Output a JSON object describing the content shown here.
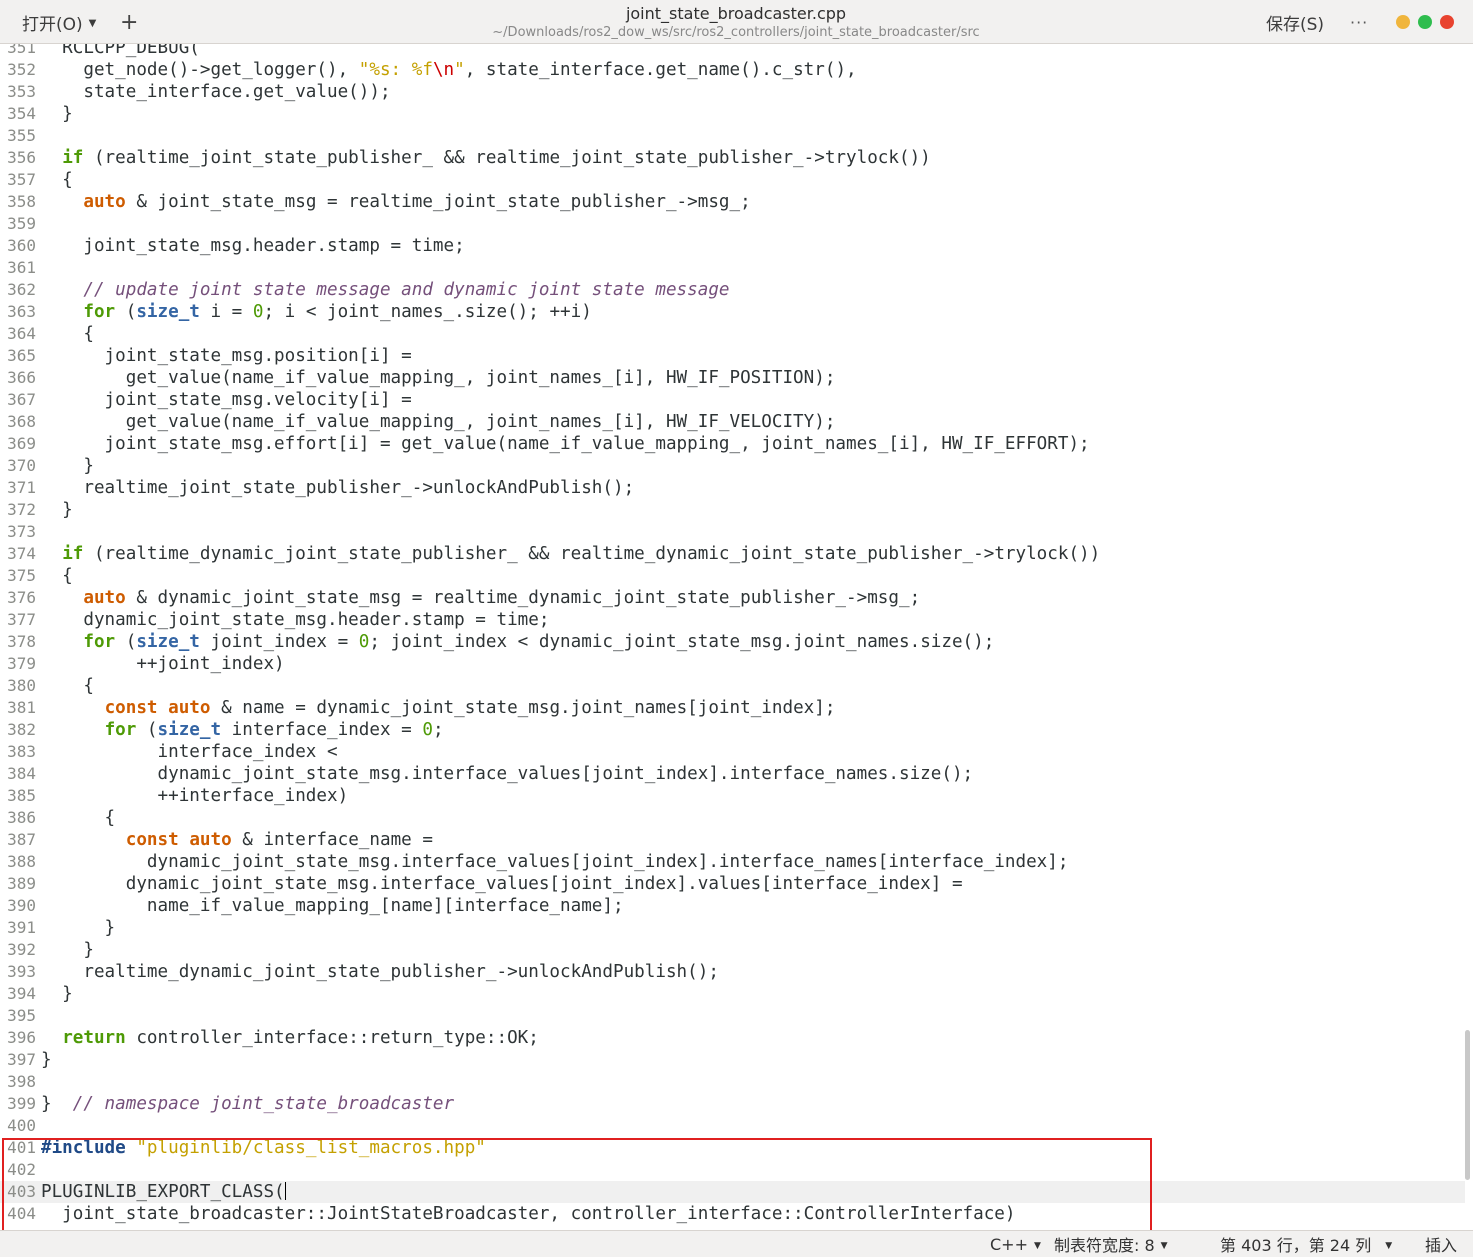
{
  "header": {
    "open_label": "打开(O)",
    "new_tab_symbol": "+",
    "title": "joint_state_broadcaster.cpp",
    "subtitle": "~/Downloads/ros2_dow_ws/src/ros2_controllers/joint_state_broadcaster/src",
    "save_label": "保存(S)",
    "more_symbol": "···"
  },
  "colors": {
    "keyword": "#4e9a06",
    "keyword_alt": "#ce5c00",
    "type": "#3465a4",
    "string": "#c4a000",
    "comment": "#75507b",
    "highlight_box": "#e02020"
  },
  "editor": {
    "current_line": 403,
    "lines": [
      {
        "n": "351",
        "t": [
          [
            "  RCLCPP_DEBUG(",
            ""
          ]
        ]
      },
      {
        "n": "352",
        "t": [
          [
            "    get_node()->get_logger(), ",
            ""
          ],
          [
            "\"%s: %f",
            "str"
          ],
          [
            "\\n",
            "esc"
          ],
          [
            "\"",
            "str"
          ],
          [
            ", state_interface.get_name().c_str(),",
            ""
          ]
        ]
      },
      {
        "n": "353",
        "t": [
          [
            "    state_interface.get_value());",
            ""
          ]
        ]
      },
      {
        "n": "354",
        "t": [
          [
            "  }",
            ""
          ]
        ]
      },
      {
        "n": "355",
        "t": []
      },
      {
        "n": "356",
        "t": [
          [
            "  ",
            ""
          ],
          [
            "if",
            "kw"
          ],
          [
            " (realtime_joint_state_publisher_ && realtime_joint_state_publisher_->trylock())",
            ""
          ]
        ]
      },
      {
        "n": "357",
        "t": [
          [
            "  {",
            ""
          ]
        ]
      },
      {
        "n": "358",
        "t": [
          [
            "    ",
            ""
          ],
          [
            "auto",
            "kw2"
          ],
          [
            " & joint_state_msg = realtime_joint_state_publisher_->msg_;",
            ""
          ]
        ]
      },
      {
        "n": "359",
        "t": []
      },
      {
        "n": "360",
        "t": [
          [
            "    joint_state_msg.header.stamp = time;",
            ""
          ]
        ]
      },
      {
        "n": "361",
        "t": []
      },
      {
        "n": "362",
        "t": [
          [
            "    ",
            ""
          ],
          [
            "// update joint state message and dynamic joint state message",
            "cmt"
          ]
        ]
      },
      {
        "n": "363",
        "t": [
          [
            "    ",
            ""
          ],
          [
            "for",
            "kw"
          ],
          [
            " (",
            ""
          ],
          [
            "size_t",
            "ty"
          ],
          [
            " i = ",
            ""
          ],
          [
            "0",
            "num"
          ],
          [
            "; i < joint_names_.size(); ++i)",
            ""
          ]
        ]
      },
      {
        "n": "364",
        "t": [
          [
            "    {",
            ""
          ]
        ]
      },
      {
        "n": "365",
        "t": [
          [
            "      joint_state_msg.position[i] =",
            ""
          ]
        ]
      },
      {
        "n": "366",
        "t": [
          [
            "        get_value(name_if_value_mapping_, joint_names_[i], HW_IF_POSITION);",
            ""
          ]
        ]
      },
      {
        "n": "367",
        "t": [
          [
            "      joint_state_msg.velocity[i] =",
            ""
          ]
        ]
      },
      {
        "n": "368",
        "t": [
          [
            "        get_value(name_if_value_mapping_, joint_names_[i], HW_IF_VELOCITY);",
            ""
          ]
        ]
      },
      {
        "n": "369",
        "t": [
          [
            "      joint_state_msg.effort[i] = get_value(name_if_value_mapping_, joint_names_[i], HW_IF_EFFORT);",
            ""
          ]
        ]
      },
      {
        "n": "370",
        "t": [
          [
            "    }",
            ""
          ]
        ]
      },
      {
        "n": "371",
        "t": [
          [
            "    realtime_joint_state_publisher_->unlockAndPublish();",
            ""
          ]
        ]
      },
      {
        "n": "372",
        "t": [
          [
            "  }",
            ""
          ]
        ]
      },
      {
        "n": "373",
        "t": []
      },
      {
        "n": "374",
        "t": [
          [
            "  ",
            ""
          ],
          [
            "if",
            "kw"
          ],
          [
            " (realtime_dynamic_joint_state_publisher_ && realtime_dynamic_joint_state_publisher_->trylock())",
            ""
          ]
        ]
      },
      {
        "n": "375",
        "t": [
          [
            "  {",
            ""
          ]
        ]
      },
      {
        "n": "376",
        "t": [
          [
            "    ",
            ""
          ],
          [
            "auto",
            "kw2"
          ],
          [
            " & dynamic_joint_state_msg = realtime_dynamic_joint_state_publisher_->msg_;",
            ""
          ]
        ]
      },
      {
        "n": "377",
        "t": [
          [
            "    dynamic_joint_state_msg.header.stamp = time;",
            ""
          ]
        ]
      },
      {
        "n": "378",
        "t": [
          [
            "    ",
            ""
          ],
          [
            "for",
            "kw"
          ],
          [
            " (",
            ""
          ],
          [
            "size_t",
            "ty"
          ],
          [
            " joint_index = ",
            ""
          ],
          [
            "0",
            "num"
          ],
          [
            "; joint_index < dynamic_joint_state_msg.joint_names.size();",
            ""
          ]
        ]
      },
      {
        "n": "379",
        "t": [
          [
            "         ++joint_index)",
            ""
          ]
        ]
      },
      {
        "n": "380",
        "t": [
          [
            "    {",
            ""
          ]
        ]
      },
      {
        "n": "381",
        "t": [
          [
            "      ",
            ""
          ],
          [
            "const",
            "kw2"
          ],
          [
            " ",
            ""
          ],
          [
            "auto",
            "kw2"
          ],
          [
            " & name = dynamic_joint_state_msg.joint_names[joint_index];",
            ""
          ]
        ]
      },
      {
        "n": "382",
        "t": [
          [
            "      ",
            ""
          ],
          [
            "for",
            "kw"
          ],
          [
            " (",
            ""
          ],
          [
            "size_t",
            "ty"
          ],
          [
            " interface_index = ",
            ""
          ],
          [
            "0",
            "num"
          ],
          [
            ";",
            ""
          ]
        ]
      },
      {
        "n": "383",
        "t": [
          [
            "           interface_index <",
            ""
          ]
        ]
      },
      {
        "n": "384",
        "t": [
          [
            "           dynamic_joint_state_msg.interface_values[joint_index].interface_names.size();",
            ""
          ]
        ]
      },
      {
        "n": "385",
        "t": [
          [
            "           ++interface_index)",
            ""
          ]
        ]
      },
      {
        "n": "386",
        "t": [
          [
            "      {",
            ""
          ]
        ]
      },
      {
        "n": "387",
        "t": [
          [
            "        ",
            ""
          ],
          [
            "const",
            "kw2"
          ],
          [
            " ",
            ""
          ],
          [
            "auto",
            "kw2"
          ],
          [
            " & interface_name =",
            ""
          ]
        ]
      },
      {
        "n": "388",
        "t": [
          [
            "          dynamic_joint_state_msg.interface_values[joint_index].interface_names[interface_index];",
            ""
          ]
        ]
      },
      {
        "n": "389",
        "t": [
          [
            "        dynamic_joint_state_msg.interface_values[joint_index].values[interface_index] =",
            ""
          ]
        ]
      },
      {
        "n": "390",
        "t": [
          [
            "          name_if_value_mapping_[name][interface_name];",
            ""
          ]
        ]
      },
      {
        "n": "391",
        "t": [
          [
            "      }",
            ""
          ]
        ]
      },
      {
        "n": "392",
        "t": [
          [
            "    }",
            ""
          ]
        ]
      },
      {
        "n": "393",
        "t": [
          [
            "    realtime_dynamic_joint_state_publisher_->unlockAndPublish();",
            ""
          ]
        ]
      },
      {
        "n": "394",
        "t": [
          [
            "  }",
            ""
          ]
        ]
      },
      {
        "n": "395",
        "t": []
      },
      {
        "n": "396",
        "t": [
          [
            "  ",
            ""
          ],
          [
            "return",
            "kw"
          ],
          [
            " controller_interface::return_type::OK;",
            ""
          ]
        ]
      },
      {
        "n": "397",
        "t": [
          [
            "}",
            ""
          ]
        ]
      },
      {
        "n": "398",
        "t": []
      },
      {
        "n": "399",
        "t": [
          [
            "}  ",
            ""
          ],
          [
            "// namespace joint_state_broadcaster",
            "cmt"
          ]
        ]
      },
      {
        "n": "400",
        "t": []
      },
      {
        "n": "401",
        "t": [
          [
            "#include",
            "pp"
          ],
          [
            " ",
            ""
          ],
          [
            "\"pluginlib/class_list_macros.hpp\"",
            "str"
          ]
        ]
      },
      {
        "n": "402",
        "t": []
      },
      {
        "n": "403",
        "t": [
          [
            "PLUGINLIB_EXPORT_CLASS(",
            ""
          ]
        ],
        "cursor": true
      },
      {
        "n": "404",
        "t": [
          [
            "  joint_state_broadcaster::JointStateBroadcaster, controller_interface::ControllerInterface)",
            ""
          ]
        ]
      }
    ]
  },
  "status": {
    "language": "C++",
    "tab_width": "制表符宽度: 8",
    "position": "第 403 行，第 24 列",
    "mode": "插入"
  }
}
